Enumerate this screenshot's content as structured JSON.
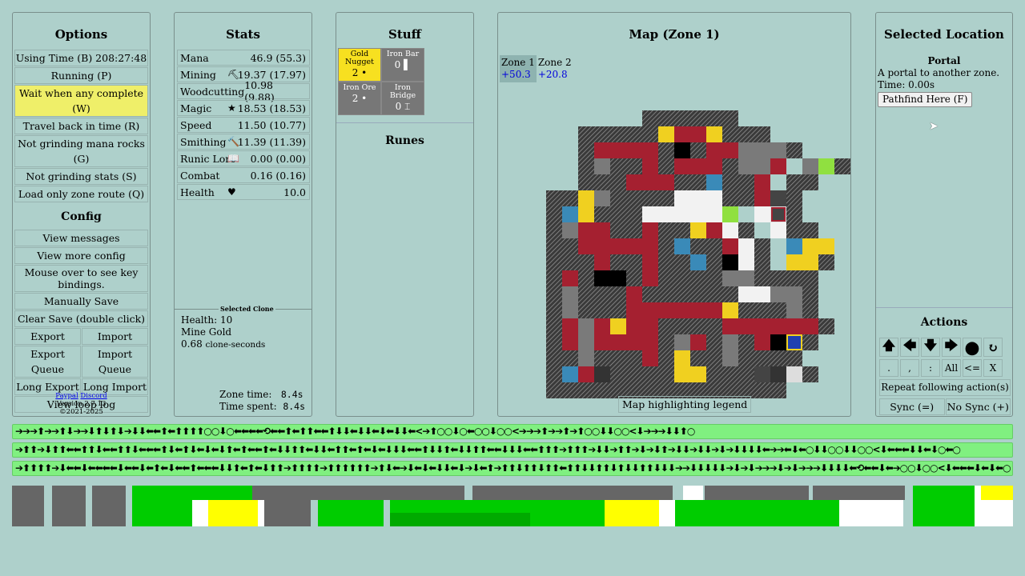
{
  "options": {
    "title": "Options",
    "items": [
      "Using Time (B) 208:27:48",
      "Running (P)",
      "Wait when any complete (W)",
      "Travel back in time (R)",
      "Not grinding mana rocks (G)",
      "Not grinding stats (S)",
      "Load only zone route (Q)"
    ],
    "config_title": "Config",
    "config": [
      "View messages",
      "View more config",
      "Mouse over to see key bindings.",
      "Manually Save",
      "Clear Save (double click)"
    ],
    "pairs": [
      [
        "Export",
        "Import"
      ],
      [
        "Export Queue",
        "Import Queue"
      ],
      [
        "Long Export",
        "Long Import"
      ]
    ],
    "loop_log": "View loop log",
    "paypal": "Paypal",
    "discord": "Discord",
    "version": "Version 2.7.13",
    "copyright": "©2021-2025"
  },
  "stats": {
    "title": "Stats",
    "rows": [
      {
        "name": "Mana",
        "icon": "",
        "value": "46.9 (55.3)"
      },
      {
        "name": "Mining",
        "icon": "⛏",
        "value": "19.37 (17.97)"
      },
      {
        "name": "Woodcutting",
        "icon": "",
        "value": "10.98 (9.88)"
      },
      {
        "name": "Magic",
        "icon": "★",
        "value": "18.53 (18.53)"
      },
      {
        "name": "Speed",
        "icon": "",
        "value": "11.50 (10.77)"
      },
      {
        "name": "Smithing",
        "icon": "🔨",
        "value": "11.39 (11.39)"
      },
      {
        "name": "Runic Lore",
        "icon": "📖",
        "value": "0.00 (0.00)"
      },
      {
        "name": "Combat",
        "icon": "",
        "value": "0.16 (0.16)"
      },
      {
        "name": "Health",
        "icon": "♥",
        "value": "10.0"
      }
    ],
    "clone_title": "Selected Clone",
    "clone_health": "Health: 10",
    "clone_action": "Mine Gold",
    "clone_seconds": "0.68",
    "clone_unit": "clone-seconds",
    "zone_time_label": "Zone time:",
    "zone_time": "8.4",
    "time_spent_label": "Time spent:",
    "time_spent": "8.4",
    "unit": "s"
  },
  "stuff": {
    "title": "Stuff",
    "items": [
      {
        "name": "Gold Nugget",
        "count": "2 •",
        "style": "gold"
      },
      {
        "name": "Iron Bar",
        "count": "0 ▌",
        "style": "grey"
      },
      {
        "name": "Iron Ore",
        "count": "2 •",
        "style": "grey"
      },
      {
        "name": "Iron Bridge",
        "count": "0 ⌶",
        "style": "grey"
      }
    ],
    "runes_title": "Runes"
  },
  "map": {
    "title": "Map (Zone 1)",
    "zones": [
      {
        "name": "Zone 1",
        "gain": "+50.3"
      },
      {
        "name": "Zone 2",
        "gain": "+20.8"
      }
    ],
    "legend": "Map highlighting legend",
    "rows": [
      "..................",
      "......HHHHHH......",
      "..HHHHHYRRYHHH....",
      "..HRRRRHKHRRGGGH..",
      "..HGHHRHRRRHGGR.GLH",
      "..HHHRRRHHBHHR.HH.",
      "HHYGHHHHWWWHHRPH..",
      "HBYHHHWWWWWL.WEH..",
      "HGRRHHRHHYRWH.WHH.",
      "HHRRRRRHBHHRWH.BYY",
      "HHHRHHRHHBHKWH.YYH",
      "HRHKKHRHHHHGGHHHH.",
      "HGHHHRHHHHHHWWGGH.",
      "HGHHHRRRRRRYHHHGH.",
      "HRGRYRRHHHHRRRRRRH",
      "HRGRRRRHGRHGHRKOH.",
      "HHGHHHRHYHHGHHHH..",
      "HBRMHHHHYYHHHPMSH.",
      "HHHHHHHHHHHHHHH..."
    ],
    "colors": {
      "H": "hatch",
      "R": "#a52030",
      "Y": "#f0d020",
      "K": "#000000",
      "G": "#7a7a7a",
      "B": "#3a8ab8",
      "W": "#f2f2f2",
      "E": "#e0e0e0",
      "L": "#90e040",
      "D": "#206a20",
      "P": "#444444",
      "M": "#333333",
      "O": "#2040b0",
      "S": "#dddddd",
      "T": "#4a4a4a"
    }
  },
  "selloc": {
    "title": "Selected Location",
    "name": "Portal",
    "desc": "A portal to another zone.",
    "time": "Time: 0.00s",
    "button": "Pathfind Here (F)",
    "actions_title": "Actions",
    "arrows": [
      "🡅",
      "🡄",
      "🡇",
      "🡆",
      "⬤",
      "↻"
    ],
    "keys": [
      ".",
      ",",
      ":",
      "All",
      "<=",
      "X"
    ],
    "repeat": "Repeat following action(s)",
    "sync": "Sync (=)",
    "nosync": "No Sync (+)"
  },
  "queues": [
    "➔➔➔⬆➔➔⬆⬇➔➔⬇⬆⬇⬆⬇➔⬇⬇⬅⬅⬆⬅⬆⬆⬆⬆○○⬇○⬅⬅⬅⬅⟲⬅⬅⬆⬅⬆⬆⬅⬅⬆⬇⬇⬅⬇⬇⬅⬇⬅⬇⬇⬅<➔⬆○○⬇○⬅○○⬇○○<➔➔➔⬆➔➔⬆➔⬆○○⬇⬇○○<⬇➔➔➔⬇⬇⬆○",
    "➔⬆⬆➔⬇⬆⬆⬅⬅⬆⬆⬇⬅⬅⬆⬆⬇⬅⬅⬅⬆⬇⬅⬆⬇⬅⬇⬅⬇⬆⬅⬆⬅⬅⬆⬅⬇⬇⬆⬆⬅⬇⬇⬅⬆⬆⬅⬆⬅⬇⬅⬇⬇⬇⬅⬅⬆⬇⬇⬆⬅⬇⬇⬆⬆⬅⬅⬇⬇⬇⬅⬅⬆⬆⬆➔⬆⬆⬆➔⬇⬇➔⬆⬆➔⬇➔⬇⬆➔⬇⬇➔⬇⬇➔⬇➔⬇⬇⬇⬇⬅➔➔⬅⬇⬅○⬇⬇○○⬇⬇○○<⬇⬅⬅⬅⬇⬇⬅⬇○⬅○",
    "➔⬆⬆⬆⬆➔⬇⬅⬅⬇⬅⬅⬅⬅⬇⬅⬅⬇⬅⬆⬅⬇⬅⬅⬆⬅⬅⬅⬇⬇⬆⬅⬆⬅⬇⬆⬆➔⬆⬆⬆⬆➔⬆⬆⬆⬆⬆⬆➔⬆⬇⬅➔⬇⬅⬇⬅⬇⬇⬅⬇➔⬇⬅⬆➔⬆⬆⬇⬆⬆⬇⬆⬆⬅⬆⬆⬇⬇⬆⬆⬇⬆⬇⬇⬆⬆⬇⬇⬇➔➔⬇⬇⬇⬇⬇➔⬇➔⬇➔➔➔⬇➔⬇➔➔➔⬇⬇⬇⬇⬅⟲⬅⬅⬇⬅➔○○⬇○○<⬇⬅⬅⬅⬇⬅⬇⬅○"
  ]
}
